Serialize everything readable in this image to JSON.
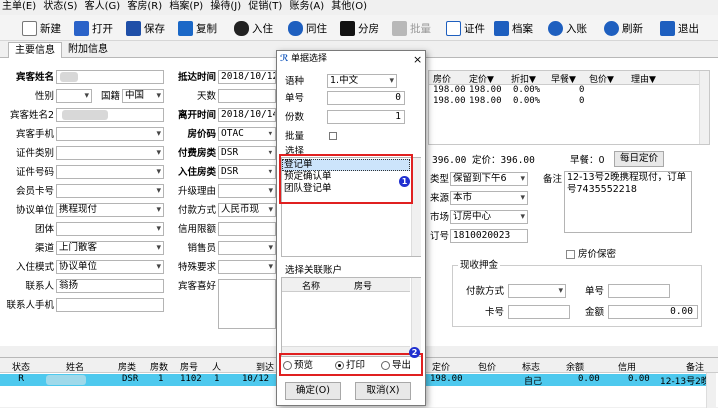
{
  "menu": [
    "主单(E)",
    "状态(S)",
    "客人(G)",
    "客房(R)",
    "档案(P)",
    "操待(J)",
    "促销(T)",
    "账务(A)",
    "其他(O)"
  ],
  "toolbar": {
    "new": "新建",
    "open": "打开",
    "save": "保存",
    "copy": "复制",
    "checkin": "入住",
    "cohabit": "同住",
    "split": "分房",
    "batch": "批量",
    "cert": "证件",
    "profile": "档案",
    "post": "入账",
    "refresh": "刷新",
    "exit": "退出"
  },
  "tabs": [
    "主要信息",
    "附加信息"
  ],
  "form": {
    "guest_name_label": "宾客姓名",
    "gender_label": "性别",
    "nation_label": "国籍",
    "nation_value": "中国",
    "guest_name2_label": "宾客姓名2",
    "guest_phone_label": "宾客手机",
    "id_type_label": "证件类别",
    "id_no_label": "证件号码",
    "member_label": "会员卡号",
    "agreement_label": "协议单位",
    "agreement_value": "携程现付",
    "group_label": "团体",
    "channel_label": "渠道",
    "channel_value": "上门散客",
    "checkin_unit_label": "入住模式",
    "checkin_unit_value": "协议单位",
    "contact_label": "联系人",
    "contact_value": "翁扬",
    "contact_phone_label": "联系人手机",
    "arrive_label": "抵达时间",
    "arrive_value": "2018/10/12",
    "days_label": "天数",
    "leave_label": "离开时间",
    "leave_value": "2018/10/14",
    "rate_code_label": "房价码",
    "rate_code_value": "OTAC",
    "pay_room_label": "付费房类",
    "pay_room_value": "DSR",
    "in_room_label": "入住房类",
    "in_room_value": "DSR",
    "upgrade_label": "升级理由",
    "pay_method_label": "付款方式",
    "pay_method_value": "人民币现",
    "credit_label": "信用限额",
    "sales_label": "销售员",
    "special_label": "特殊要求",
    "hobby_label": "宾客喜好"
  },
  "rate_grid": {
    "headers": [
      "房价",
      "定价▼",
      "折扣▼",
      "早餐▼",
      "包价▼",
      "理由▼"
    ],
    "rows": [
      [
        "198.00",
        "198.00",
        "0.00%",
        "0",
        ""
      ],
      [
        "198.00",
        "198.00",
        "0.00%",
        "0",
        ""
      ]
    ]
  },
  "right": {
    "price_row": "396.00  定价：396.00",
    "breakfast": "早餐：0",
    "daily_rate_btn": "每日定价",
    "type_label": "类型",
    "type_value": "保留到下午6",
    "remark_label": "备注",
    "remark_value": "12-13号2晚携程现付，订单号7435552218",
    "source_label": "来源",
    "source_value": "本市",
    "market_label": "市场",
    "market_value": "订房中心",
    "order_label": "订号",
    "order_value": "1810020023",
    "secret_label": "房价保密",
    "deposit_title": "现收押金",
    "pay_method_label": "付款方式",
    "card_no_label": "单号",
    "card_label": "卡号",
    "amount_label": "金额",
    "amount_value": "0.00"
  },
  "dialog": {
    "title": "单据选择",
    "lang_label": "语种",
    "lang_value": "1.中文",
    "no_label": "单号",
    "no_value": "0",
    "copies_label": "份数",
    "copies_value": "1",
    "batch_label": "批量",
    "select_label": "选择",
    "options": [
      "登记单",
      "预定确认单",
      "团队登记单"
    ],
    "related_label": "选择关联账户",
    "col_name": "名称",
    "col_room": "房号",
    "radio_preview": "预览",
    "radio_print": "打印",
    "radio_export": "导出",
    "ok_btn": "确定(O)",
    "cancel_btn": "取消(X)",
    "badge1": "1",
    "badge2": "2"
  },
  "status_grid": {
    "headers": [
      "状态",
      "姓名",
      "房类",
      "房数",
      "房号",
      "人",
      "到达",
      "定价",
      "包价",
      "标志",
      "余额",
      "信用",
      "备注"
    ],
    "row": [
      "R",
      "",
      "DSR",
      "1",
      "1102",
      "1",
      "10/12",
      "198.00",
      "",
      "自己",
      "0.00",
      "0.00",
      "12-13号2晚"
    ]
  }
}
